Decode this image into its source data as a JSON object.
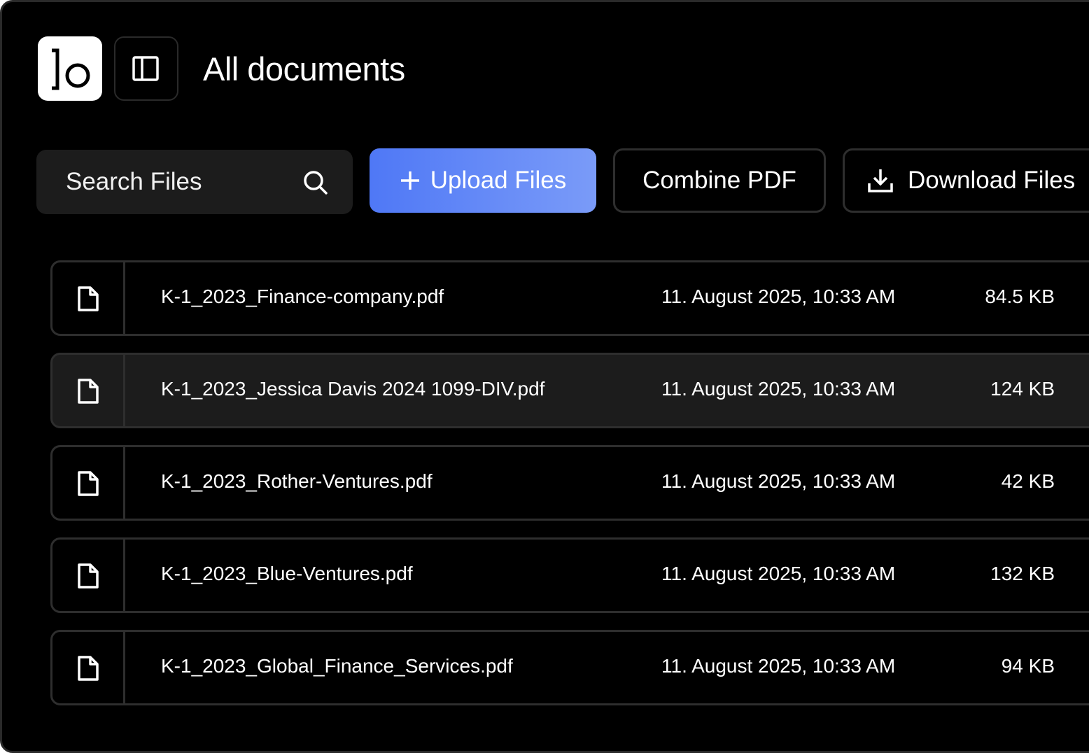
{
  "header": {
    "logo_icon": "lo-logo-icon",
    "sidebar_toggle_icon": "sidebar-panel-icon",
    "title": "All documents"
  },
  "toolbar": {
    "search_placeholder": "Search Files",
    "search_icon": "search-icon",
    "upload_label": "Upload Files",
    "upload_icon": "plus-icon",
    "combine_label": "Combine PDF",
    "download_label": "Download Files",
    "download_icon": "download-icon"
  },
  "colors": {
    "background": "#000000",
    "accent": "#5b82f7",
    "surface": "#1c1c1c",
    "border": "#2e2e2e",
    "text": "#ffffff"
  },
  "files": [
    {
      "name": "K-1_2023_Finance-company.pdf",
      "date": "11. August 2025, 10:33 AM",
      "size": "84.5 KB",
      "icon": "file-icon",
      "selected": false
    },
    {
      "name": "K-1_2023_Jessica Davis 2024 1099-DIV.pdf",
      "date": "11. August 2025, 10:33 AM",
      "size": "124 KB",
      "icon": "file-icon",
      "selected": true
    },
    {
      "name": "K-1_2023_Rother-Ventures.pdf",
      "date": "11. August 2025, 10:33 AM",
      "size": "42 KB",
      "icon": "file-icon",
      "selected": false
    },
    {
      "name": "K-1_2023_Blue-Ventures.pdf",
      "date": "11. August 2025, 10:33 AM",
      "size": "132 KB",
      "icon": "file-icon",
      "selected": false
    },
    {
      "name": "K-1_2023_Global_Finance_Services.pdf",
      "date": "11. August 2025, 10:33 AM",
      "size": "94 KB",
      "icon": "file-icon",
      "selected": false
    }
  ]
}
